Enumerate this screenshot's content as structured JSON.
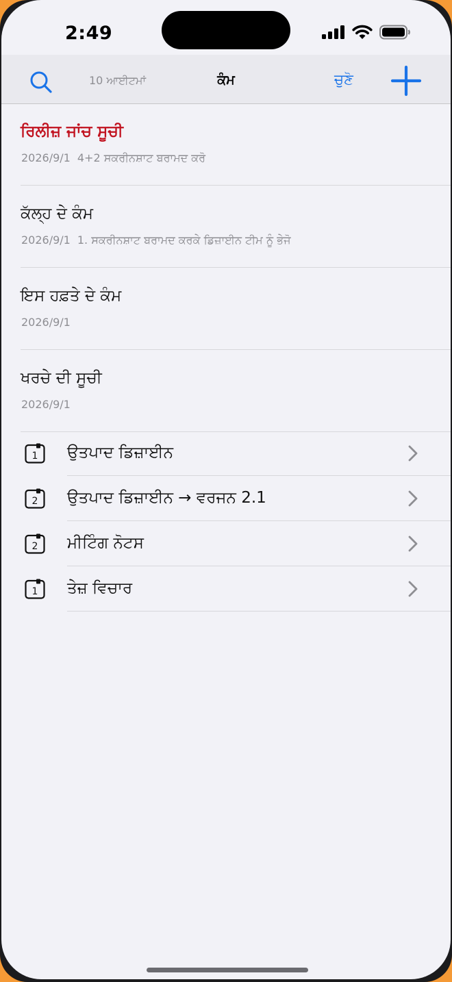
{
  "status_bar": {
    "time": "2:49"
  },
  "nav": {
    "item_count": "10 ਆਈਟਮਾਂ",
    "title": "ਕੰਮ",
    "select_label": "ਚੁਣੋ",
    "search_icon": "search-icon",
    "add_icon": "plus-icon"
  },
  "tasks": [
    {
      "title": "ਰਿਲੀਜ਼ ਜਾਂਚ ਸੂਚੀ",
      "date": "2026/9/1",
      "note": "4+2 ਸਕਰੀਨਸ਼ਾਟ ਬਰਾਮਦ ਕਰੋ",
      "highlight": true
    },
    {
      "title": "ਕੱਲ੍ਹ ਦੇ ਕੰਮ",
      "date": "2026/9/1",
      "note": "1. ਸਕਰੀਨਸ਼ਾਟ ਬਰਾਮਦ ਕਰਕੇ ਡਿਜ਼ਾਈਨ ਟੀਮ ਨੂੰ ਭੇਜੋ",
      "highlight": false
    },
    {
      "title": "ਇਸ ਹਫ਼ਤੇ ਦੇ ਕੰਮ",
      "date": "2026/9/1",
      "note": "",
      "highlight": false
    },
    {
      "title": "ਖਰਚੇ ਦੀ ਸੂਚੀ",
      "date": "2026/9/1",
      "note": "",
      "highlight": false
    }
  ],
  "folders": [
    {
      "badge": "1",
      "label": "ਉਤਪਾਦ ਡਿਜ਼ਾਈਨ"
    },
    {
      "badge": "2",
      "label": "ਉਤਪਾਦ ਡਿਜ਼ਾਈਨ → ਵਰਜਨ 2.1"
    },
    {
      "badge": "2",
      "label": "ਮੀਟਿੰਗ ਨੋਟਸ"
    },
    {
      "badge": "1",
      "label": "ਤੇਜ਼ ਵਿਚਾਰ"
    }
  ],
  "colors": {
    "accent": "#1a73e8",
    "highlight_title": "#c1121f",
    "background": "#f2f2f7",
    "frame_orange": "#f59a36"
  }
}
